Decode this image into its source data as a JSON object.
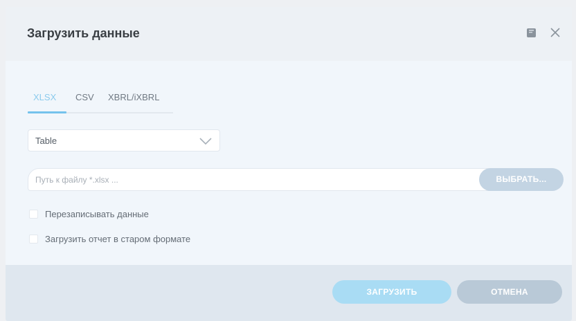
{
  "dialog": {
    "title": "Загрузить данные",
    "help_icon": "help-book-icon",
    "close_icon": "close-icon"
  },
  "tabs": [
    {
      "label": "XLSX",
      "active": true
    },
    {
      "label": "CSV",
      "active": false
    },
    {
      "label": "XBRL/iXBRL",
      "active": false
    }
  ],
  "select": {
    "value": "Table",
    "icon": "chevron-down-icon"
  },
  "file": {
    "placeholder": "Путь к файлу *.xlsx ...",
    "value": "",
    "choose_label": "ВЫБРАТЬ..."
  },
  "options": [
    {
      "label": "Перезаписывать данные",
      "checked": false
    },
    {
      "label": "Загрузить отчет в старом формате",
      "checked": false
    }
  ],
  "footer": {
    "upload_label": "ЗАГРУЗИТЬ",
    "cancel_label": "ОТМЕНА"
  },
  "colors": {
    "accent": "#74c2ec",
    "upload_button": "#a9dcf4",
    "cancel_button": "#b9c9d7"
  }
}
